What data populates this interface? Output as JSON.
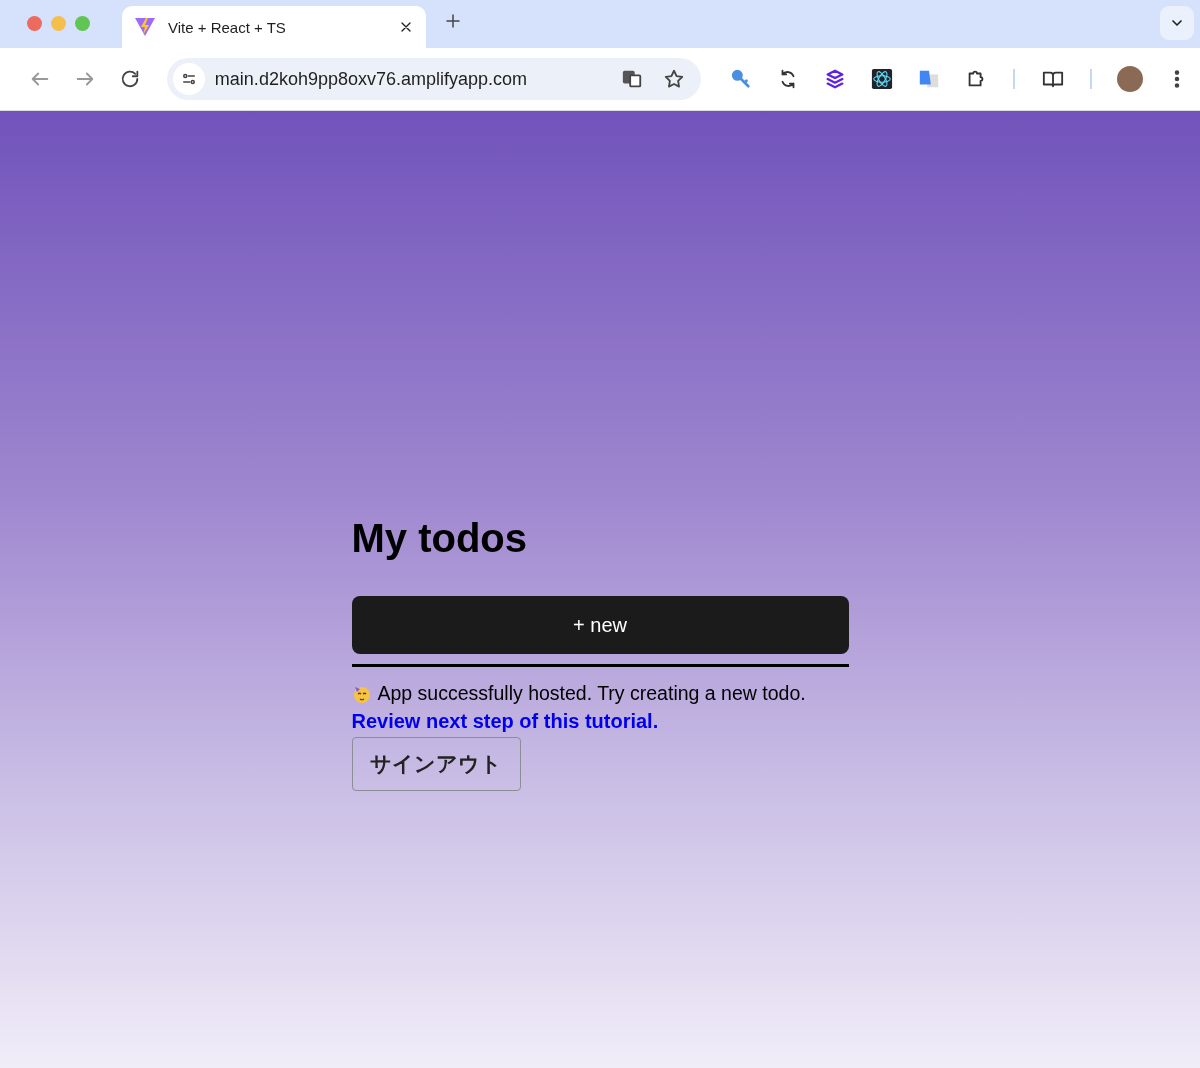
{
  "browser": {
    "tabs": [
      {
        "title": "Vite + React + TS",
        "selected": true
      }
    ],
    "address": "main.d2koh9pp8oxv76.amplifyapp.com"
  },
  "page": {
    "heading": "My todos",
    "new_button": "+ new",
    "message": "App successfully hosted. Try creating a new todo.",
    "link": "Review next step of this tutorial.",
    "sign_out_button": "サインアウト"
  }
}
